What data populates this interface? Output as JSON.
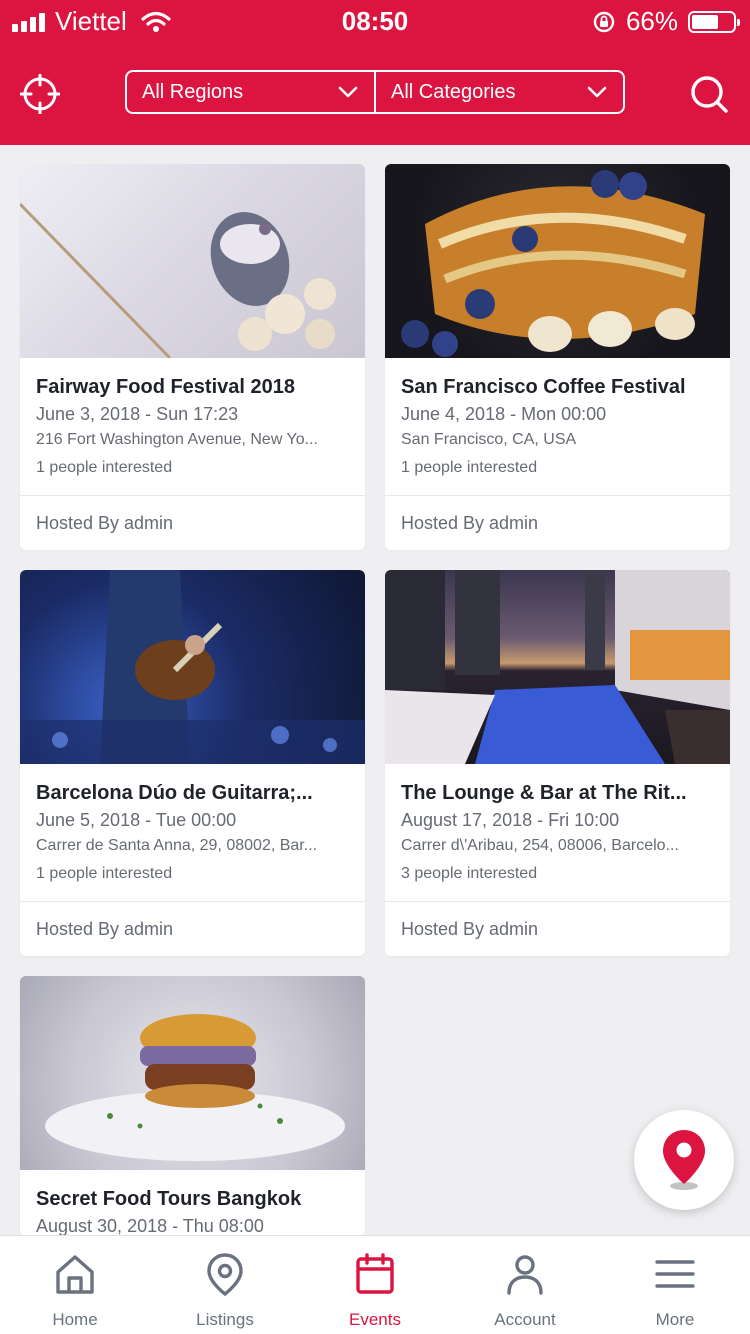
{
  "status_bar": {
    "carrier": "Viettel",
    "time": "08:50",
    "battery": "66%",
    "battery_level": 0.66
  },
  "header": {
    "locate_icon": "crosshair-icon",
    "search_icon": "search-icon",
    "region_filter": "All Regions",
    "category_filter": "All Categories",
    "background_color": "#dc1440"
  },
  "events": [
    {
      "title": "Fairway Food Festival 2018",
      "date": "June 3, 2018 - Sun 17:23",
      "address": "216 Fort Washington Avenue, New Yo...",
      "interested": "1 people interested",
      "host": "Hosted By admin"
    },
    {
      "title": "San Francisco Coffee Festival",
      "date": "June 4, 2018 - Mon 00:00",
      "address": "San Francisco, CA, USA",
      "interested": "1 people interested",
      "host": "Hosted By admin"
    },
    {
      "title": "Barcelona Dúo de Guitarra;...",
      "date": "June 5, 2018 - Tue 00:00",
      "address": "Carrer de Santa Anna, 29, 08002, Bar...",
      "interested": "1 people interested",
      "host": "Hosted By admin"
    },
    {
      "title": "The Lounge & Bar at The Rit...",
      "date": "August 17, 2018 - Fri 10:00",
      "address": "Carrer d\\'Aribau, 254, 08006, Barcelo...",
      "interested": "3 people interested",
      "host": "Hosted By admin"
    },
    {
      "title": "Secret Food Tours Bangkok",
      "date": "August 30, 2018 - Thu 08:00",
      "address": "",
      "interested": "",
      "host": ""
    }
  ],
  "tabs": [
    {
      "label": "Home",
      "icon": "home-icon",
      "active": false
    },
    {
      "label": "Listings",
      "icon": "map-pin-icon",
      "active": false
    },
    {
      "label": "Events",
      "icon": "calendar-icon",
      "active": true
    },
    {
      "label": "Account",
      "icon": "user-icon",
      "active": false
    },
    {
      "label": "More",
      "icon": "menu-icon",
      "active": false
    }
  ],
  "fab": {
    "icon": "map-marker-icon",
    "color": "#dc1440"
  },
  "colors": {
    "accent": "#dc1440",
    "inactive": "#6a7280"
  }
}
